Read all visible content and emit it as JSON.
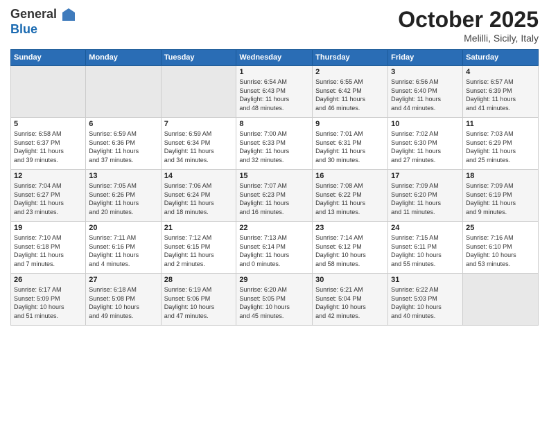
{
  "logo": {
    "general": "General",
    "blue": "Blue"
  },
  "title": "October 2025",
  "location": "Melilli, Sicily, Italy",
  "days_of_week": [
    "Sunday",
    "Monday",
    "Tuesday",
    "Wednesday",
    "Thursday",
    "Friday",
    "Saturday"
  ],
  "weeks": [
    [
      {
        "day": "",
        "info": ""
      },
      {
        "day": "",
        "info": ""
      },
      {
        "day": "",
        "info": ""
      },
      {
        "day": "1",
        "info": "Sunrise: 6:54 AM\nSunset: 6:43 PM\nDaylight: 11 hours\nand 48 minutes."
      },
      {
        "day": "2",
        "info": "Sunrise: 6:55 AM\nSunset: 6:42 PM\nDaylight: 11 hours\nand 46 minutes."
      },
      {
        "day": "3",
        "info": "Sunrise: 6:56 AM\nSunset: 6:40 PM\nDaylight: 11 hours\nand 44 minutes."
      },
      {
        "day": "4",
        "info": "Sunrise: 6:57 AM\nSunset: 6:39 PM\nDaylight: 11 hours\nand 41 minutes."
      }
    ],
    [
      {
        "day": "5",
        "info": "Sunrise: 6:58 AM\nSunset: 6:37 PM\nDaylight: 11 hours\nand 39 minutes."
      },
      {
        "day": "6",
        "info": "Sunrise: 6:59 AM\nSunset: 6:36 PM\nDaylight: 11 hours\nand 37 minutes."
      },
      {
        "day": "7",
        "info": "Sunrise: 6:59 AM\nSunset: 6:34 PM\nDaylight: 11 hours\nand 34 minutes."
      },
      {
        "day": "8",
        "info": "Sunrise: 7:00 AM\nSunset: 6:33 PM\nDaylight: 11 hours\nand 32 minutes."
      },
      {
        "day": "9",
        "info": "Sunrise: 7:01 AM\nSunset: 6:31 PM\nDaylight: 11 hours\nand 30 minutes."
      },
      {
        "day": "10",
        "info": "Sunrise: 7:02 AM\nSunset: 6:30 PM\nDaylight: 11 hours\nand 27 minutes."
      },
      {
        "day": "11",
        "info": "Sunrise: 7:03 AM\nSunset: 6:29 PM\nDaylight: 11 hours\nand 25 minutes."
      }
    ],
    [
      {
        "day": "12",
        "info": "Sunrise: 7:04 AM\nSunset: 6:27 PM\nDaylight: 11 hours\nand 23 minutes."
      },
      {
        "day": "13",
        "info": "Sunrise: 7:05 AM\nSunset: 6:26 PM\nDaylight: 11 hours\nand 20 minutes."
      },
      {
        "day": "14",
        "info": "Sunrise: 7:06 AM\nSunset: 6:24 PM\nDaylight: 11 hours\nand 18 minutes."
      },
      {
        "day": "15",
        "info": "Sunrise: 7:07 AM\nSunset: 6:23 PM\nDaylight: 11 hours\nand 16 minutes."
      },
      {
        "day": "16",
        "info": "Sunrise: 7:08 AM\nSunset: 6:22 PM\nDaylight: 11 hours\nand 13 minutes."
      },
      {
        "day": "17",
        "info": "Sunrise: 7:09 AM\nSunset: 6:20 PM\nDaylight: 11 hours\nand 11 minutes."
      },
      {
        "day": "18",
        "info": "Sunrise: 7:09 AM\nSunset: 6:19 PM\nDaylight: 11 hours\nand 9 minutes."
      }
    ],
    [
      {
        "day": "19",
        "info": "Sunrise: 7:10 AM\nSunset: 6:18 PM\nDaylight: 11 hours\nand 7 minutes."
      },
      {
        "day": "20",
        "info": "Sunrise: 7:11 AM\nSunset: 6:16 PM\nDaylight: 11 hours\nand 4 minutes."
      },
      {
        "day": "21",
        "info": "Sunrise: 7:12 AM\nSunset: 6:15 PM\nDaylight: 11 hours\nand 2 minutes."
      },
      {
        "day": "22",
        "info": "Sunrise: 7:13 AM\nSunset: 6:14 PM\nDaylight: 11 hours\nand 0 minutes."
      },
      {
        "day": "23",
        "info": "Sunrise: 7:14 AM\nSunset: 6:12 PM\nDaylight: 10 hours\nand 58 minutes."
      },
      {
        "day": "24",
        "info": "Sunrise: 7:15 AM\nSunset: 6:11 PM\nDaylight: 10 hours\nand 55 minutes."
      },
      {
        "day": "25",
        "info": "Sunrise: 7:16 AM\nSunset: 6:10 PM\nDaylight: 10 hours\nand 53 minutes."
      }
    ],
    [
      {
        "day": "26",
        "info": "Sunrise: 6:17 AM\nSunset: 5:09 PM\nDaylight: 10 hours\nand 51 minutes."
      },
      {
        "day": "27",
        "info": "Sunrise: 6:18 AM\nSunset: 5:08 PM\nDaylight: 10 hours\nand 49 minutes."
      },
      {
        "day": "28",
        "info": "Sunrise: 6:19 AM\nSunset: 5:06 PM\nDaylight: 10 hours\nand 47 minutes."
      },
      {
        "day": "29",
        "info": "Sunrise: 6:20 AM\nSunset: 5:05 PM\nDaylight: 10 hours\nand 45 minutes."
      },
      {
        "day": "30",
        "info": "Sunrise: 6:21 AM\nSunset: 5:04 PM\nDaylight: 10 hours\nand 42 minutes."
      },
      {
        "day": "31",
        "info": "Sunrise: 6:22 AM\nSunset: 5:03 PM\nDaylight: 10 hours\nand 40 minutes."
      },
      {
        "day": "",
        "info": ""
      }
    ]
  ]
}
